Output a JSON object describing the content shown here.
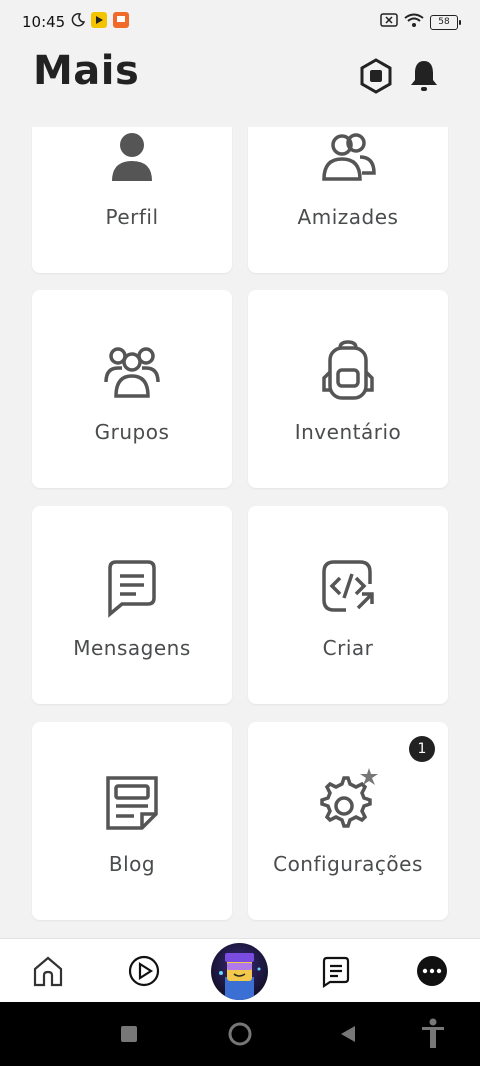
{
  "status_bar": {
    "time": "10:45",
    "battery": "58"
  },
  "header": {
    "title": "Mais"
  },
  "tiles": [
    {
      "label": "Perfil"
    },
    {
      "label": "Amizades"
    },
    {
      "label": "Grupos"
    },
    {
      "label": "Inventário"
    },
    {
      "label": "Mensagens"
    },
    {
      "label": "Criar"
    },
    {
      "label": "Blog"
    },
    {
      "label": "Configurações",
      "badge": "1"
    }
  ],
  "bottom_nav": {
    "items": [
      "home-icon",
      "play-icon",
      "avatar",
      "chat-icon",
      "more-icon"
    ]
  },
  "colors": {
    "background": "#f2f2f3",
    "tile": "#ffffff",
    "text": "#4a4c4e",
    "badge": "#222222"
  }
}
